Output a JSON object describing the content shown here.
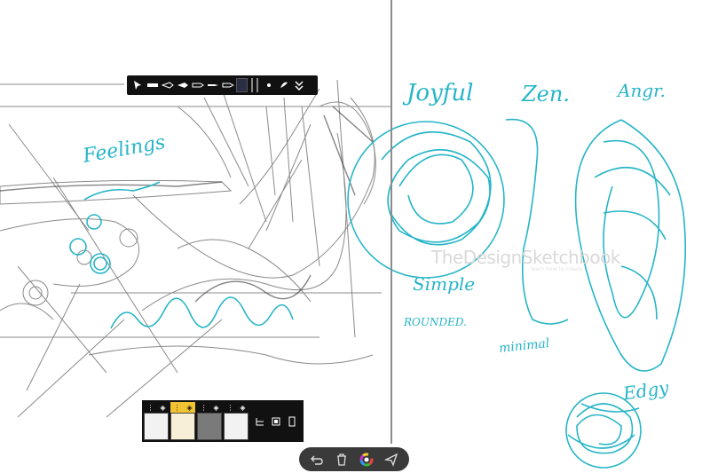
{
  "canvas": {
    "accent_color": "#27b5c7",
    "left_label": "Feelings",
    "words": {
      "joyful": "Joyful",
      "zen": "Zen.",
      "angry": "Angr.",
      "simple": "Simple",
      "rounded": "ROUNDED.",
      "minimal": "minimal",
      "edgy": "Edgy"
    },
    "watermark": "TheDesignSketchbook",
    "watermark_sub": "learn how to create"
  },
  "brush_toolbar": {
    "tools": [
      "select-icon",
      "marker-icon",
      "pen-icon",
      "pencil-icon",
      "brush-icon",
      "airbrush-icon",
      "fineliner-icon"
    ],
    "current_color": "#2a2f45",
    "icons": [
      "dot-icon",
      "brush-shape-icon",
      "expand-icon"
    ]
  },
  "layers": {
    "items": [
      {
        "name": "layer-1",
        "active": false
      },
      {
        "name": "layer-2",
        "active": true
      },
      {
        "name": "layer-3",
        "active": false
      },
      {
        "name": "layer-4",
        "active": false
      }
    ]
  },
  "action_bar": {
    "icons": [
      "undo-icon",
      "trash-icon",
      "color-wheel-icon",
      "share-icon"
    ]
  }
}
